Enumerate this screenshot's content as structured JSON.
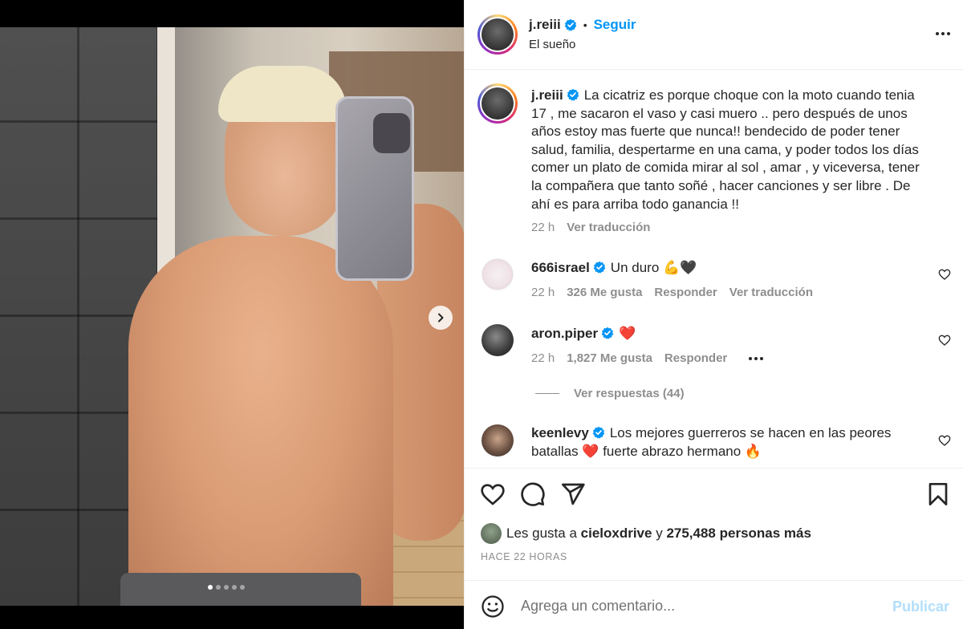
{
  "post": {
    "media": {
      "carousel_total": 5,
      "carousel_active": 1,
      "next_icon": "chevron-right-icon"
    },
    "header": {
      "username": "j.reiii",
      "separator": "•",
      "follow_label": "Seguir",
      "location": "El sueño",
      "more_icon": "more-horizontal-icon"
    },
    "caption": {
      "username": "j.reiii",
      "text": "La cicatriz es porque choque con la moto cuando tenia 17 , me sacaron el vaso y casi muero .. pero después de unos años estoy mas fuerte que nunca!! bendecido de poder tener salud, familia, despertarme en una cama, y poder todos los días comer un plato de comida mirar al sol , amar , y viceversa, tener la compañera que tanto soñé , hacer canciones y ser libre . De ahí es para arriba todo ganancia !!",
      "time": "22 h",
      "translate_label": "Ver traducción"
    },
    "comments": [
      {
        "username": "666israel",
        "text": "Un duro 💪🖤",
        "time": "22 h",
        "likes": "326 Me gusta",
        "reply_label": "Responder",
        "translate_label": "Ver traducción"
      },
      {
        "username": "aron.piper",
        "text": "❤️",
        "time": "22 h",
        "likes": "1,827 Me gusta",
        "reply_label": "Responder",
        "view_replies": "Ver respuestas (44)"
      },
      {
        "username": "keenlevy",
        "text": "Los mejores guerreros se hacen en las peores batallas ❤️ fuerte abrazo hermano 🔥"
      }
    ],
    "likes": {
      "prefix": "Les gusta a",
      "user": "cieloxdrive",
      "connector": "y",
      "others": "275,488 personas más"
    },
    "timestamp": "HACE 22 HORAS",
    "add_comment": {
      "placeholder": "Agrega un comentario...",
      "publish_label": "Publicar"
    }
  },
  "colors": {
    "accent": "#0095f6",
    "publish_disabled": "#b2dffc",
    "secondary_text": "#8e8e8e",
    "verified": "#0095f6",
    "heart_red": "#ed4956"
  }
}
